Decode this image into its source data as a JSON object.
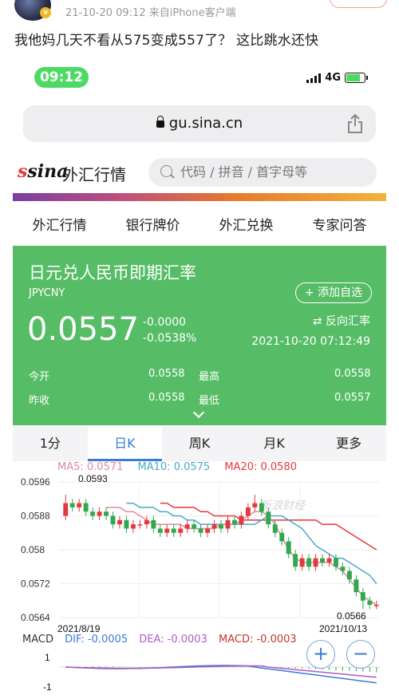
{
  "post": {
    "meta": "21-10-20 09:12  来自iPhone客户端",
    "text": "我他妈几天不看从575变成557了？ 这比跳水还快"
  },
  "phone": {
    "time": "09:12",
    "network": "4G",
    "url": "gu.sina.cn"
  },
  "sina": {
    "logo": "sina",
    "title": "外汇行情",
    "search_placeholder": "代码 / 拼音 / 首字母等"
  },
  "nav": [
    "外汇行情",
    "银行牌价",
    "外汇兑换",
    "专家问答"
  ],
  "quote": {
    "title": "日元兑人民币即期汇率",
    "code": "JPYCNY",
    "add_label": "+ 添加自选",
    "price": "0.0557",
    "change": "-0.0000",
    "change_pct": "-0.0538%",
    "reverse_label": "⇄ 反向汇率",
    "time": "2021-10-20 07:12:49",
    "open_label": "今开",
    "open": "0.0558",
    "high_label": "最高",
    "high": "0.0558",
    "prev_label": "昨收",
    "prev": "0.0558",
    "low_label": "最低",
    "low": "0.0557"
  },
  "chart_tabs": [
    "1分",
    "日K",
    "周K",
    "月K",
    "更多"
  ],
  "active_tab": 1,
  "colors": {
    "up": "#e4393c",
    "down": "#2fa84f",
    "ma5": "#e4393c",
    "ma10": "#4aa8c8",
    "ma20": "#e08aa0",
    "green_panel": "#56bd66",
    "accent": "#3a7bd5"
  },
  "ma": {
    "ma5": "MA5: 0.0571",
    "ma10": "MA10: 0.0575",
    "ma20": "MA20: 0.0580"
  },
  "macd": {
    "label": "MACD",
    "dif": "DIF: -0.0005",
    "dea": "DEA: -0.0003",
    "macd": "MACD: -0.0003",
    "yticks": [
      "1",
      "-1"
    ]
  },
  "watermark": "新浪财经",
  "chart_data": {
    "type": "candlestick",
    "yticks": [
      "0.0596",
      "0.0588",
      "0.058",
      "0.0572",
      "0.0564"
    ],
    "ylim": [
      0.0564,
      0.0596
    ],
    "x_start": "2021/8/19",
    "x_end": "2021/10/13",
    "max_label": "0.0593",
    "min_label": "0.0566",
    "candles": [
      [
        0.0588,
        0.0591,
        0.0593,
        0.0587
      ],
      [
        0.0591,
        0.059,
        0.0592,
        0.0589
      ],
      [
        0.059,
        0.0591,
        0.0592,
        0.0589
      ],
      [
        0.0591,
        0.0589,
        0.0592,
        0.0588
      ],
      [
        0.0589,
        0.0588,
        0.059,
        0.0587
      ],
      [
        0.0588,
        0.0589,
        0.059,
        0.0587
      ],
      [
        0.0589,
        0.0588,
        0.059,
        0.0587
      ],
      [
        0.0588,
        0.0586,
        0.0589,
        0.0585
      ],
      [
        0.0586,
        0.0587,
        0.0588,
        0.0585
      ],
      [
        0.0587,
        0.0585,
        0.0588,
        0.0584
      ],
      [
        0.0585,
        0.0586,
        0.0587,
        0.0584
      ],
      [
        0.0586,
        0.0586,
        0.0587,
        0.0585
      ],
      [
        0.0586,
        0.0587,
        0.0588,
        0.0585
      ],
      [
        0.0587,
        0.0585,
        0.0588,
        0.0584
      ],
      [
        0.0585,
        0.0584,
        0.0586,
        0.0583
      ],
      [
        0.0584,
        0.0585,
        0.0586,
        0.0583
      ],
      [
        0.0585,
        0.0584,
        0.0586,
        0.0583
      ],
      [
        0.0584,
        0.0585,
        0.0586,
        0.0583
      ],
      [
        0.0585,
        0.0586,
        0.0587,
        0.0584
      ],
      [
        0.0586,
        0.0585,
        0.0587,
        0.0584
      ],
      [
        0.0585,
        0.0584,
        0.0586,
        0.0583
      ],
      [
        0.0584,
        0.0585,
        0.0586,
        0.0583
      ],
      [
        0.0585,
        0.0586,
        0.0587,
        0.0584
      ],
      [
        0.0586,
        0.0585,
        0.0587,
        0.0584
      ],
      [
        0.0585,
        0.0587,
        0.0588,
        0.0584
      ],
      [
        0.0587,
        0.0586,
        0.0588,
        0.0585
      ],
      [
        0.0586,
        0.0588,
        0.0589,
        0.0585
      ],
      [
        0.0588,
        0.059,
        0.0591,
        0.0587
      ],
      [
        0.059,
        0.0591,
        0.0593,
        0.0589
      ],
      [
        0.0591,
        0.0589,
        0.0592,
        0.0588
      ],
      [
        0.0589,
        0.0586,
        0.059,
        0.0585
      ],
      [
        0.0586,
        0.0584,
        0.0587,
        0.0583
      ],
      [
        0.0584,
        0.0582,
        0.0585,
        0.0581
      ],
      [
        0.0582,
        0.0579,
        0.0583,
        0.0578
      ],
      [
        0.0579,
        0.0576,
        0.058,
        0.0575
      ],
      [
        0.0576,
        0.0578,
        0.0579,
        0.0575
      ],
      [
        0.0578,
        0.0576,
        0.0579,
        0.0575
      ],
      [
        0.0576,
        0.0578,
        0.0579,
        0.0575
      ],
      [
        0.0578,
        0.0577,
        0.0579,
        0.0576
      ],
      [
        0.0577,
        0.0578,
        0.0579,
        0.0576
      ],
      [
        0.0578,
        0.0576,
        0.0579,
        0.0575
      ],
      [
        0.0576,
        0.0575,
        0.0577,
        0.0574
      ],
      [
        0.0575,
        0.0573,
        0.0576,
        0.0572
      ],
      [
        0.0573,
        0.057,
        0.0574,
        0.0569
      ],
      [
        0.057,
        0.0568,
        0.0571,
        0.0566
      ],
      [
        0.0568,
        0.0567,
        0.0569,
        0.0566
      ],
      [
        0.0567,
        0.0567,
        0.0568,
        0.0566
      ]
    ],
    "ma5": [
      0.059,
      0.059,
      0.059,
      0.0589,
      0.0589,
      0.0588,
      0.0587,
      0.0586,
      0.0586,
      0.0586,
      0.0586,
      0.0586,
      0.0585,
      0.0585,
      0.0585,
      0.0585,
      0.0585,
      0.0586,
      0.0586,
      0.0586,
      0.0587,
      0.0588,
      0.0589,
      0.0589,
      0.0588,
      0.0586,
      0.0583,
      0.058,
      0.0578,
      0.0577,
      0.0577,
      0.0577,
      0.0577,
      0.0577,
      0.0576,
      0.0575,
      0.0573,
      0.0571,
      0.0569,
      0.0568,
      0.0567
    ],
    "ma10": [
      0.0591,
      0.0591,
      0.059,
      0.059,
      0.059,
      0.0589,
      0.0589,
      0.0588,
      0.0588,
      0.0587,
      0.0587,
      0.0586,
      0.0586,
      0.0586,
      0.0586,
      0.0586,
      0.0586,
      0.0586,
      0.0586,
      0.0586,
      0.0587,
      0.0588,
      0.0588,
      0.0588,
      0.0587,
      0.0586,
      0.0585,
      0.0583,
      0.0581,
      0.058,
      0.0579,
      0.0578,
      0.0578,
      0.0577,
      0.0576,
      0.0575,
      0.0574,
      0.0572
    ],
    "ma20": [
      0.0591,
      0.0591,
      0.059,
      0.059,
      0.059,
      0.059,
      0.0589,
      0.0589,
      0.0588,
      0.0588,
      0.0588,
      0.0588,
      0.0587,
      0.0587,
      0.0587,
      0.0587,
      0.0587,
      0.0587,
      0.0587,
      0.0587,
      0.0587,
      0.0587,
      0.0587,
      0.0587,
      0.0586,
      0.0586,
      0.0586,
      0.0585,
      0.0584,
      0.0583,
      0.0582,
      0.0581,
      0.058
    ]
  }
}
